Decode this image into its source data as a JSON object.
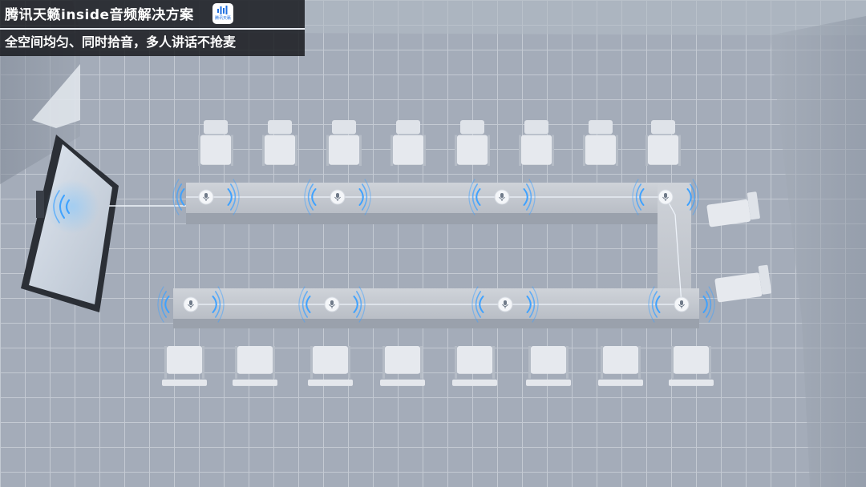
{
  "banner": {
    "title": "腾讯天籁inside音频解决方案",
    "subtitle": "全空间均匀、同时拾音，多人讲话不抢麦"
  },
  "logo": {
    "text": "腾讯天籁",
    "icon": "waveform-logo"
  },
  "scene": {
    "colors": {
      "floor": "#a7afbb",
      "grid": "#c3c9d2",
      "table": "#c4c9d0",
      "chair": "#e6e9ee",
      "mic_wave": "#3fa2ff",
      "wire": "#eef3fa"
    },
    "microphone_icon": "microphone-icon",
    "sound_wave_icon": "sound-wave-icon"
  }
}
